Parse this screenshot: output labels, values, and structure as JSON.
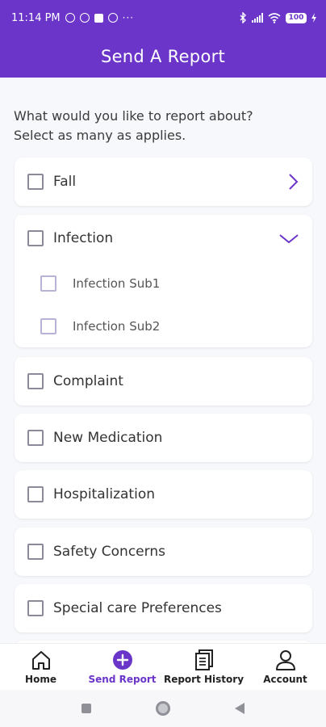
{
  "status": {
    "time": "11:14 PM",
    "dots": "···",
    "battery": "100"
  },
  "header": {
    "title": "Send A Report"
  },
  "prompt": {
    "line1": "What would you like to report about?",
    "line2": "Select as many as applies."
  },
  "categories": [
    {
      "label": "Fall"
    },
    {
      "label": "Infection",
      "subitems": [
        {
          "label": "Infection Sub1"
        },
        {
          "label": "Infection Sub2"
        }
      ]
    },
    {
      "label": "Complaint"
    },
    {
      "label": "New Medication"
    },
    {
      "label": "Hospitalization"
    },
    {
      "label": "Safety Concerns"
    },
    {
      "label": "Special care Preferences"
    }
  ],
  "nav": [
    {
      "label": "Home",
      "icon": "home-icon"
    },
    {
      "label": "Send Report",
      "icon": "plus-circle-icon"
    },
    {
      "label": "Report History",
      "icon": "document-icon"
    },
    {
      "label": "Account",
      "icon": "person-icon"
    }
  ],
  "colors": {
    "primary": "#6a35c8",
    "background": "#f6f8fb"
  }
}
